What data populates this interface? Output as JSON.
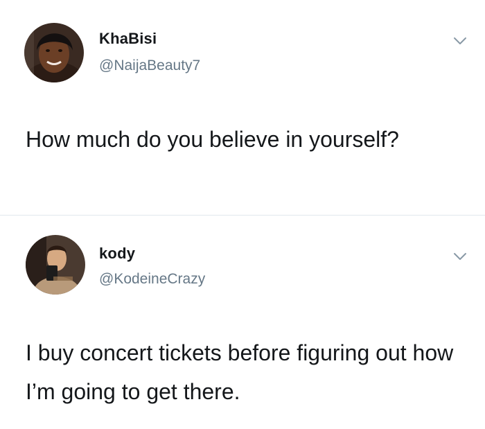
{
  "tweets": [
    {
      "name": "KhaBisi",
      "handle": "@NaijaBeauty7",
      "text": "How much do you believe in yourself?",
      "avatar_icon": "profile-photo"
    },
    {
      "name": "kody",
      "handle": "@KodeineCrazy",
      "text": "I buy concert tickets before figuring out how I’m going to get there.",
      "avatar_icon": "profile-photo"
    }
  ],
  "icons": {
    "menu": "chevron-down-icon"
  },
  "colors": {
    "name": "#14171a",
    "handle": "#657786",
    "chevron": "#8899a6",
    "divider": "#e1e8ed"
  }
}
